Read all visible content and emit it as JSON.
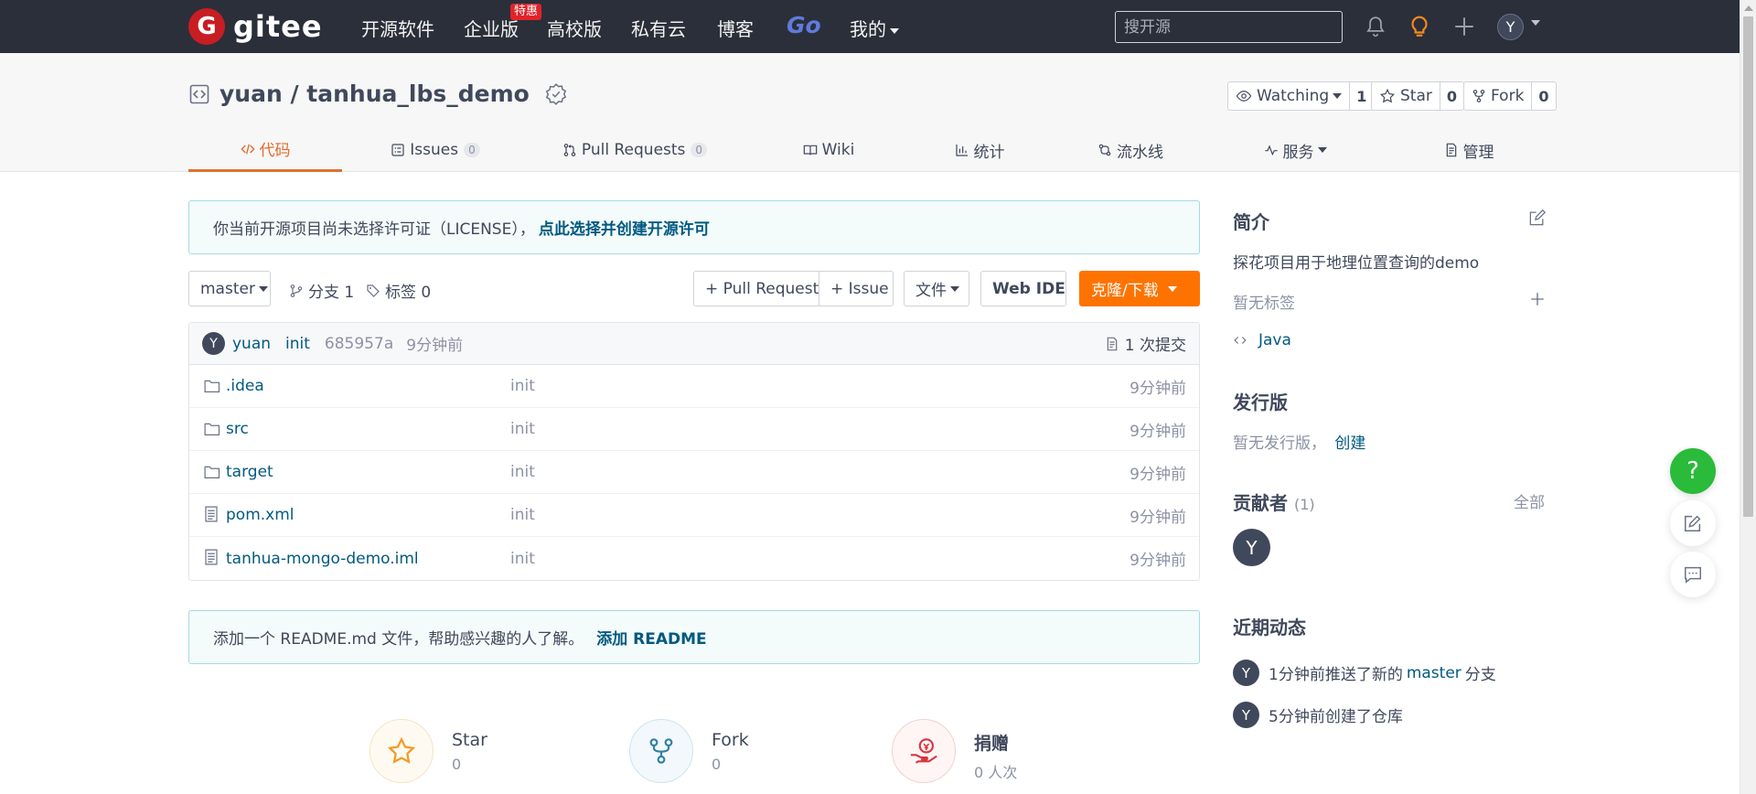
{
  "nav": {
    "logo_letter": "G",
    "logo_text": "gitee",
    "items": [
      "开源软件",
      "企业版",
      "高校版",
      "私有云",
      "博客",
      "Go",
      "我的"
    ],
    "badge": "特惠",
    "search_placeholder": "搜开源",
    "avatar": "Y"
  },
  "project": {
    "title": "yuan / tanhua_lbs_demo",
    "watch_label": "Watching",
    "watch_count": "1",
    "star_label": "Star",
    "star_count": "0",
    "fork_label": "Fork",
    "fork_count": "0"
  },
  "tabs": [
    {
      "label": "代码",
      "count": ""
    },
    {
      "label": "Issues",
      "count": "0"
    },
    {
      "label": "Pull Requests",
      "count": "0"
    },
    {
      "label": "Wiki",
      "count": ""
    },
    {
      "label": "统计",
      "count": ""
    },
    {
      "label": "流水线",
      "count": ""
    },
    {
      "label": "服务",
      "count": ""
    },
    {
      "label": "管理",
      "count": ""
    }
  ],
  "license_notice": {
    "text": "你当前开源项目尚未选择许可证（LICENSE），",
    "link": "点此选择并创建开源许可"
  },
  "toolbar": {
    "branch": "master",
    "branches": "分支 1",
    "tags": "标签 0",
    "pull_request": "+ Pull Request",
    "issue": "+ Issue",
    "file": "文件",
    "web_ide": "Web IDE",
    "clone": "克隆/下载"
  },
  "commit": {
    "avatar": "Y",
    "author": "yuan",
    "message": "init",
    "hash": "685957a",
    "time": "9分钟前",
    "count": "1 次提交"
  },
  "files": [
    {
      "name": ".idea",
      "type": "folder",
      "msg": "init",
      "time": "9分钟前"
    },
    {
      "name": "src",
      "type": "folder",
      "msg": "init",
      "time": "9分钟前"
    },
    {
      "name": "target",
      "type": "folder",
      "msg": "init",
      "time": "9分钟前"
    },
    {
      "name": "pom.xml",
      "type": "file",
      "msg": "init",
      "time": "9分钟前"
    },
    {
      "name": "tanhua-mongo-demo.iml",
      "type": "file",
      "msg": "init",
      "time": "9分钟前"
    }
  ],
  "readme_notice": {
    "text": "添加一个 README.md 文件，帮助感兴趣的人了解。",
    "link": "添加 README"
  },
  "bottom_stats": [
    {
      "title": "Star",
      "value": "0"
    },
    {
      "title": "Fork",
      "value": "0"
    },
    {
      "title": "捐赠",
      "value": "0 人次"
    }
  ],
  "sidebar": {
    "intro_title": "简介",
    "intro_text": "探花项目用于地理位置查询的demo",
    "no_tags": "暂无标签",
    "language": "Java",
    "release_title": "发行版",
    "release_text": "暂无发行版，",
    "release_link": "创建",
    "contrib_title": "贡献者",
    "contrib_count": "(1)",
    "contrib_all": "全部",
    "contrib_avatar": "Y",
    "activity_title": "近期动态",
    "activities": [
      {
        "avatar": "Y",
        "pre": "1分钟前推送了新的",
        "link": "master",
        "post": "分支"
      },
      {
        "avatar": "Y",
        "pre": "5分钟前创建了仓库",
        "link": "",
        "post": ""
      }
    ]
  },
  "floating": {
    "help": "?"
  }
}
